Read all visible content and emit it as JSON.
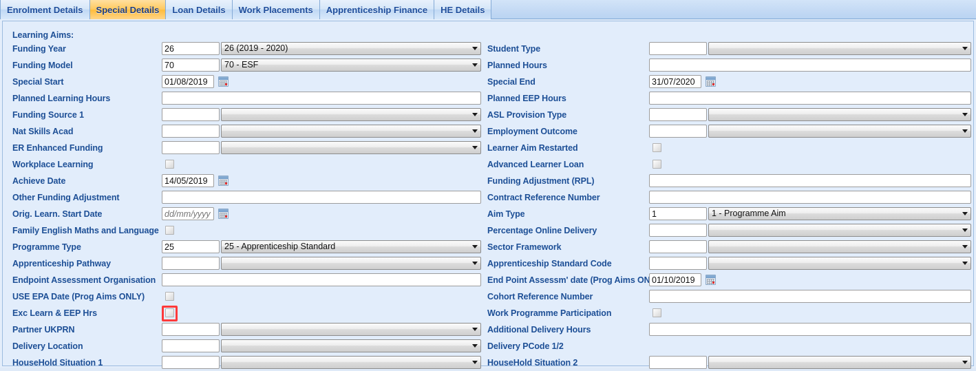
{
  "tabs": [
    {
      "label": "Enrolment Details",
      "active": false
    },
    {
      "label": "Special Details",
      "active": true
    },
    {
      "label": "Loan Details",
      "active": false
    },
    {
      "label": "Work Placements",
      "active": false
    },
    {
      "label": "Apprenticeship Finance",
      "active": false
    },
    {
      "label": "HE Details",
      "active": false
    }
  ],
  "section": {
    "heading": "Learning Aims:"
  },
  "colors": {
    "label_blue": "#1d4f96",
    "active_tab": "#ffc95f",
    "panel_bg": "#e2edfb",
    "highlight_red": "#ff3a3a"
  },
  "left": [
    {
      "label": "Funding Year",
      "type": "code-combo",
      "code": "26",
      "combo": "26 (2019 - 2020)"
    },
    {
      "label": "Funding Model",
      "type": "code-combo",
      "code": "70",
      "combo": "70 - ESF"
    },
    {
      "label": "Special Start",
      "type": "date",
      "value": "01/08/2019"
    },
    {
      "label": "Planned Learning Hours",
      "type": "wide-text",
      "value": ""
    },
    {
      "label": "Funding Source 1",
      "type": "code-combo",
      "code": "",
      "combo": ""
    },
    {
      "label": "Nat Skills Acad",
      "type": "code-combo",
      "code": "",
      "combo": ""
    },
    {
      "label": "ER Enhanced Funding",
      "type": "code-combo",
      "code": "",
      "combo": ""
    },
    {
      "label": "Workplace Learning",
      "type": "check",
      "checked": false
    },
    {
      "label": "Achieve Date",
      "type": "date",
      "value": "14/05/2019"
    },
    {
      "label": "Other Funding Adjustment",
      "type": "wide-text",
      "value": ""
    },
    {
      "label": "Orig. Learn. Start Date",
      "type": "date",
      "value": "",
      "placeholder": "dd/mm/yyyy"
    },
    {
      "label": "Family English Maths and Language",
      "type": "check",
      "checked": false
    },
    {
      "label": "Programme Type",
      "type": "code-combo",
      "code": "25",
      "combo": "25 - Apprenticeship Standard"
    },
    {
      "label": "Apprenticeship Pathway",
      "type": "code-combo",
      "code": "",
      "combo": ""
    },
    {
      "label": "Endpoint Assessment Organisation",
      "type": "wide-text",
      "value": ""
    },
    {
      "label": "USE EPA Date (Prog Aims ONLY)",
      "type": "check",
      "checked": false
    },
    {
      "label": "Exc Learn & EEP Hrs",
      "type": "check",
      "checked": false,
      "highlighted": true
    },
    {
      "label": "Partner UKPRN",
      "type": "code-combo",
      "code": "",
      "combo": ""
    },
    {
      "label": "Delivery Location",
      "type": "code-combo",
      "code": "",
      "combo": ""
    },
    {
      "label": "HouseHold Situation 1",
      "type": "code-combo",
      "code": "",
      "combo": ""
    }
  ],
  "right": [
    {
      "label": "Student Type",
      "type": "code-combo",
      "code": "",
      "combo": ""
    },
    {
      "label": "Planned Hours",
      "type": "wide-text",
      "value": ""
    },
    {
      "label": "Special End",
      "type": "date",
      "value": "31/07/2020"
    },
    {
      "label": "Planned EEP Hours",
      "type": "wide-text",
      "value": ""
    },
    {
      "label": "ASL Provision Type",
      "type": "code-combo",
      "code": "",
      "combo": ""
    },
    {
      "label": "Employment Outcome",
      "type": "code-combo",
      "code": "",
      "combo": ""
    },
    {
      "label": "Learner Aim Restarted",
      "type": "check",
      "checked": false
    },
    {
      "label": "Advanced Learner Loan",
      "type": "check",
      "checked": false
    },
    {
      "label": "Funding Adjustment (RPL)",
      "type": "wide-text",
      "value": ""
    },
    {
      "label": "Contract Reference Number",
      "type": "wide-text",
      "value": ""
    },
    {
      "label": "Aim Type",
      "type": "code-combo",
      "code": "1",
      "combo": "1 - Programme Aim"
    },
    {
      "label": "Percentage Online Delivery",
      "type": "code-combo",
      "code": "",
      "combo": ""
    },
    {
      "label": "Sector Framework",
      "type": "code-combo",
      "code": "",
      "combo": ""
    },
    {
      "label": "Apprenticeship Standard Code",
      "type": "code-combo",
      "code": "",
      "combo": ""
    },
    {
      "label": "End Point Assessm' date (Prog Aims ONLY)",
      "type": "date",
      "value": "01/10/2019"
    },
    {
      "label": "Cohort Reference Number",
      "type": "wide-text",
      "value": ""
    },
    {
      "label": "Work Programme Participation",
      "type": "check",
      "checked": false
    },
    {
      "label": "Additional Delivery Hours",
      "type": "wide-text",
      "value": ""
    },
    {
      "label": "Delivery PCode 1/2",
      "type": "none"
    },
    {
      "label": "HouseHold Situation 2",
      "type": "code-combo",
      "code": "",
      "combo": ""
    }
  ]
}
